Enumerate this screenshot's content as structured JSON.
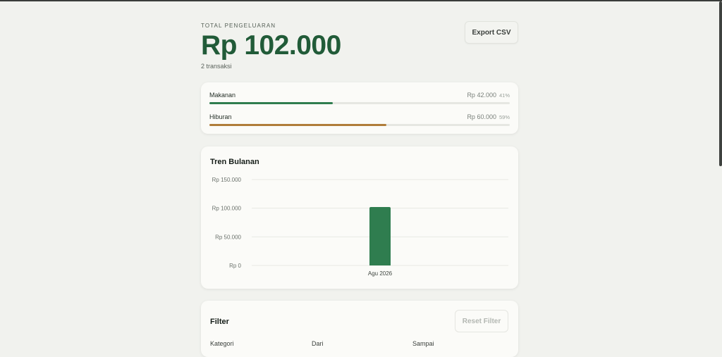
{
  "header": {
    "label": "TOTAL PENGELUARAN",
    "total": "Rp 102.000",
    "count": "2 transaksi",
    "export_label": "Export CSV"
  },
  "categories": [
    {
      "name": "Makanan",
      "amount": "Rp 42.000",
      "pct_label": "41%",
      "share": 0.41,
      "color": "#2f7d4f"
    },
    {
      "name": "Hiburan",
      "amount": "Rp 60.000",
      "pct_label": "59%",
      "share": 0.59,
      "color": "#b07d3a"
    }
  ],
  "trend": {
    "title": "Tren Bulanan"
  },
  "chart_data": {
    "type": "bar",
    "categories": [
      "Agu 2026"
    ],
    "values": [
      102000
    ],
    "ylim": [
      0,
      150000
    ],
    "yticks": [
      0,
      50000,
      100000,
      150000
    ],
    "ytick_labels": [
      "Rp 0",
      "Rp 50.000",
      "Rp 100.000",
      "Rp 150.000"
    ],
    "bar_color": "#2f7d4f",
    "grid": true
  },
  "filter": {
    "title": "Filter",
    "reset_label": "Reset Filter",
    "labels": [
      "Kategori",
      "Dari",
      "Sampai"
    ]
  }
}
